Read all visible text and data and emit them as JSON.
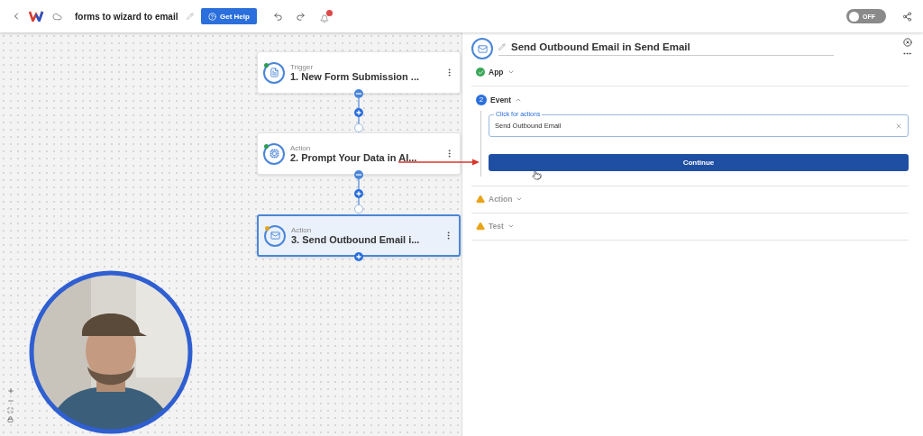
{
  "topbar": {
    "title": "forms to wizard to email",
    "help_button": "Get Help",
    "toggle": {
      "on": false,
      "label": "OFF"
    }
  },
  "nodes": [
    {
      "kind": "form",
      "type": "Trigger",
      "title": "1. New Form Submission ...",
      "selected": false,
      "color": "#2e9e4f"
    },
    {
      "kind": "ai",
      "type": "Action",
      "title": "2. Prompt Your Data in AI...",
      "selected": false,
      "color": "#2e9e4f"
    },
    {
      "kind": "email",
      "type": "Action",
      "title": "3. Send Outbound Email i...",
      "selected": true,
      "color": "#e8a317"
    }
  ],
  "panel": {
    "title": "Send Outbound Email in Send Email",
    "sections": [
      {
        "kind": "done",
        "label": "App",
        "expanded": false
      },
      {
        "kind": "current",
        "label": "Event",
        "number": "2",
        "expanded": true,
        "field": {
          "label": "Click for actions",
          "value": "Send Outbound Email"
        },
        "button": "Continue"
      },
      {
        "kind": "warning",
        "label": "Action",
        "expanded": false
      },
      {
        "kind": "warning",
        "label": "Test",
        "expanded": false
      }
    ]
  }
}
